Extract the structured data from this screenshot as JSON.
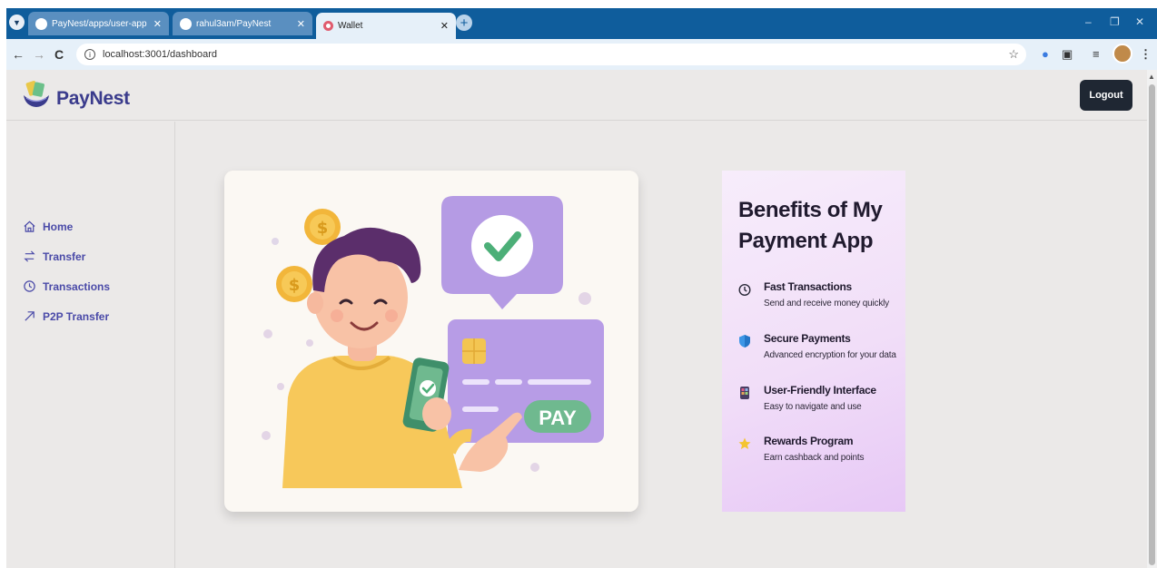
{
  "browser": {
    "tabs": [
      {
        "title": "PayNest/apps/user-app at mai"
      },
      {
        "title": "rahul3am/PayNest"
      },
      {
        "title": "Wallet"
      }
    ],
    "url": "localhost:3001/dashboard"
  },
  "header": {
    "brand": "PayNest",
    "logout_label": "Logout"
  },
  "sidebar": {
    "items": [
      {
        "label": "Home",
        "icon": "home-icon"
      },
      {
        "label": "Transfer",
        "icon": "transfer-icon"
      },
      {
        "label": "Transactions",
        "icon": "clock-icon"
      },
      {
        "label": "P2P Transfer",
        "icon": "arrow-up-right-icon"
      }
    ]
  },
  "hero": {
    "card_label": "PAY"
  },
  "benefits": {
    "title": "Benefits of My Payment App",
    "items": [
      {
        "title": "Fast Transactions",
        "desc": "Send and receive money quickly",
        "icon": "clock-icon"
      },
      {
        "title": "Secure Payments",
        "desc": "Advanced encryption for your data",
        "icon": "shield-icon"
      },
      {
        "title": "User-Friendly Interface",
        "desc": "Easy to navigate and use",
        "icon": "phone-icon"
      },
      {
        "title": "Rewards Program",
        "desc": "Earn cashback and points",
        "icon": "star-icon"
      }
    ]
  },
  "colors": {
    "brand": "#3a3b8c",
    "nav": "#4a4aa8",
    "logout_bg": "#1f2733",
    "card_purple": "#b49ae6",
    "pay_green": "#6fb98f"
  }
}
